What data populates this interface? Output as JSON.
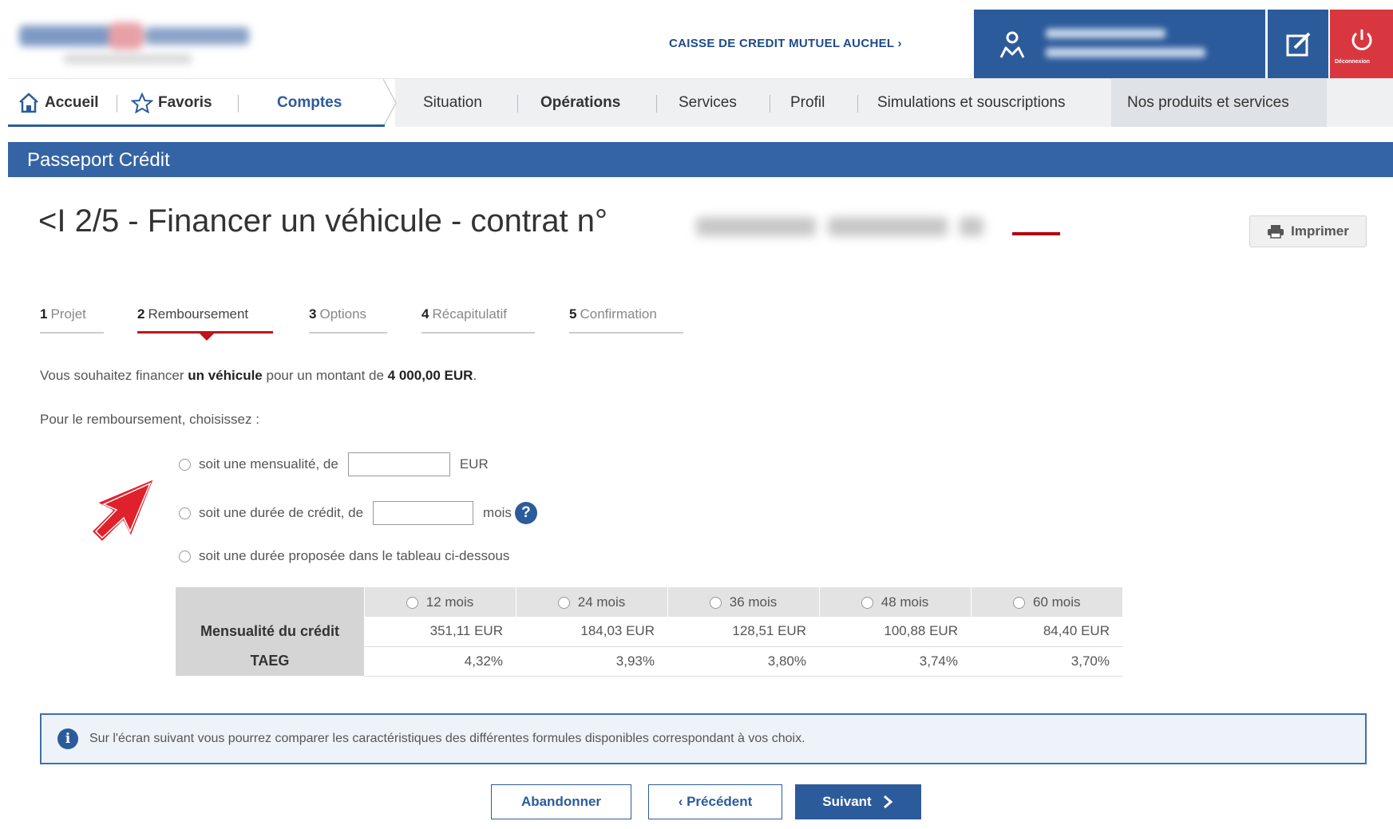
{
  "header": {
    "caisse_link": "CAISSE DE CREDIT MUTUEL AUCHEL ›",
    "logout_label": "Déconnexion"
  },
  "nav": {
    "home": "Accueil",
    "favorites": "Favoris",
    "accounts": "Comptes",
    "situation": "Situation",
    "operations": "Opérations",
    "services": "Services",
    "profile": "Profil",
    "simulations": "Simulations et souscriptions",
    "products": "Nos produits et services"
  },
  "section_title": "Passeport Crédit",
  "page": {
    "heading": "<I  2/5 - Financer un véhicule - contrat n°",
    "print_label": "Imprimer"
  },
  "steps": [
    {
      "num": "1",
      "label": "Projet"
    },
    {
      "num": "2",
      "label": "Remboursement"
    },
    {
      "num": "3",
      "label": "Options"
    },
    {
      "num": "4",
      "label": "Récapitulatif"
    },
    {
      "num": "5",
      "label": "Confirmation"
    }
  ],
  "intro": {
    "part1": "Vous souhaitez financer ",
    "vehicle": "un véhicule",
    "part2": " pour un montant de ",
    "amount": "4 000,00 EUR",
    "part3": "."
  },
  "choose_text": "Pour le remboursement, choisissez :",
  "options": {
    "monthly_label": "soit une mensualité, de",
    "monthly_unit": "EUR",
    "duration_label": "soit une durée de crédit, de",
    "duration_unit": "mois",
    "table_label": "soit une durée proposée dans le tableau ci-dessous"
  },
  "table": {
    "durations": [
      "12 mois",
      "24 mois",
      "36 mois",
      "48 mois",
      "60 mois"
    ],
    "row_monthly_label": "Mensualité du crédit",
    "monthly_values": [
      "351,11 EUR",
      "184,03 EUR",
      "128,51 EUR",
      "100,88 EUR",
      "84,40 EUR"
    ],
    "row_taeg_label": "TAEG",
    "taeg_values": [
      "4,32%",
      "3,93%",
      "3,80%",
      "3,74%",
      "3,70%"
    ]
  },
  "info_text": "Sur l'écran suivant vous pourrez comparer les caractéristiques des différentes formules disponibles correspondant à vos choix.",
  "buttons": {
    "abandon": "Abandonner",
    "previous": "‹ Précédent",
    "next": "Suivant"
  },
  "colors": {
    "brand_blue": "#2c5b9b",
    "logout_red": "#d9373f",
    "step_red": "#c0141b",
    "annotation_red": "#e0202a"
  }
}
